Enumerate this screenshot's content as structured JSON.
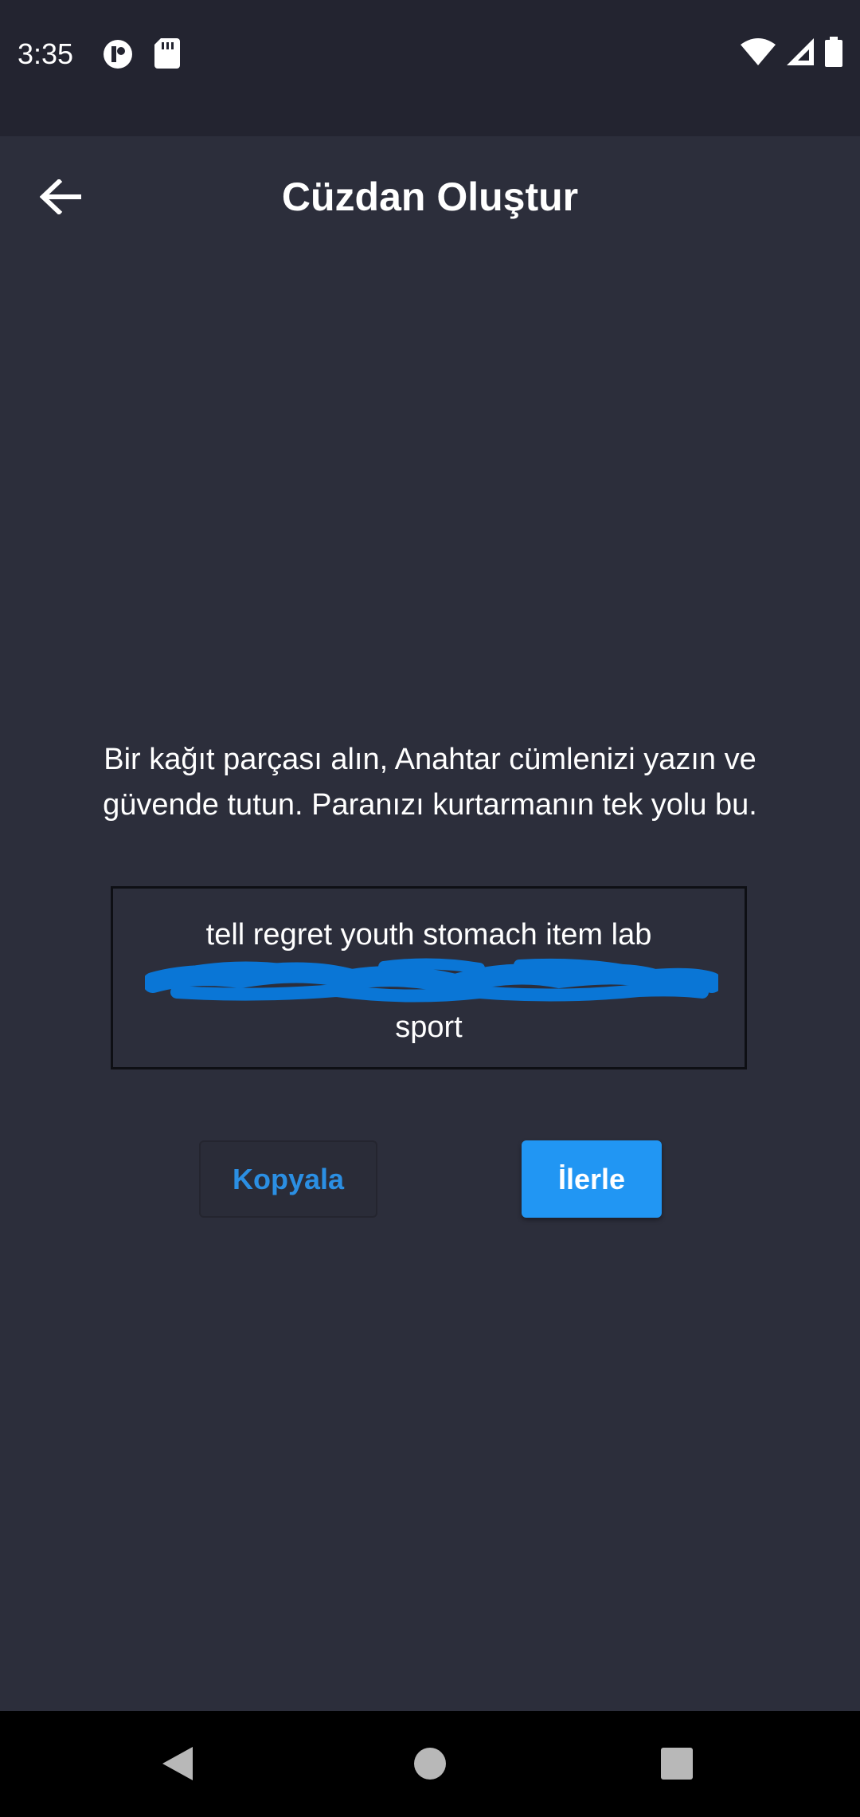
{
  "status_bar": {
    "time": "3:35",
    "left_icons": [
      "p-badge-icon",
      "sd-card-icon"
    ],
    "right_icons": [
      "wifi-icon",
      "cell-signal-icon",
      "battery-icon"
    ]
  },
  "header": {
    "title": "Cüzdan Oluştur",
    "back_icon": "arrow-left-icon"
  },
  "main": {
    "instruction": "Bir kağıt parçası alın, Anahtar cümlenizi yazın ve güvende tutun. Paranızı kurtarmanın tek yolu bu.",
    "phrase_line_1": "tell regret youth stomach item lab",
    "phrase_line_3": "sport",
    "redaction_color": "#0a76d6"
  },
  "buttons": {
    "copy_label": "Kopyala",
    "next_label": "İlerle"
  },
  "colors": {
    "background": "#2c2e3b",
    "status_bar": "#232430",
    "accent": "#2196f3",
    "copy_text": "#2b8fe3"
  },
  "nav_bar": {
    "icons": [
      "back-triangle-icon",
      "home-circle-icon",
      "recents-square-icon"
    ]
  }
}
